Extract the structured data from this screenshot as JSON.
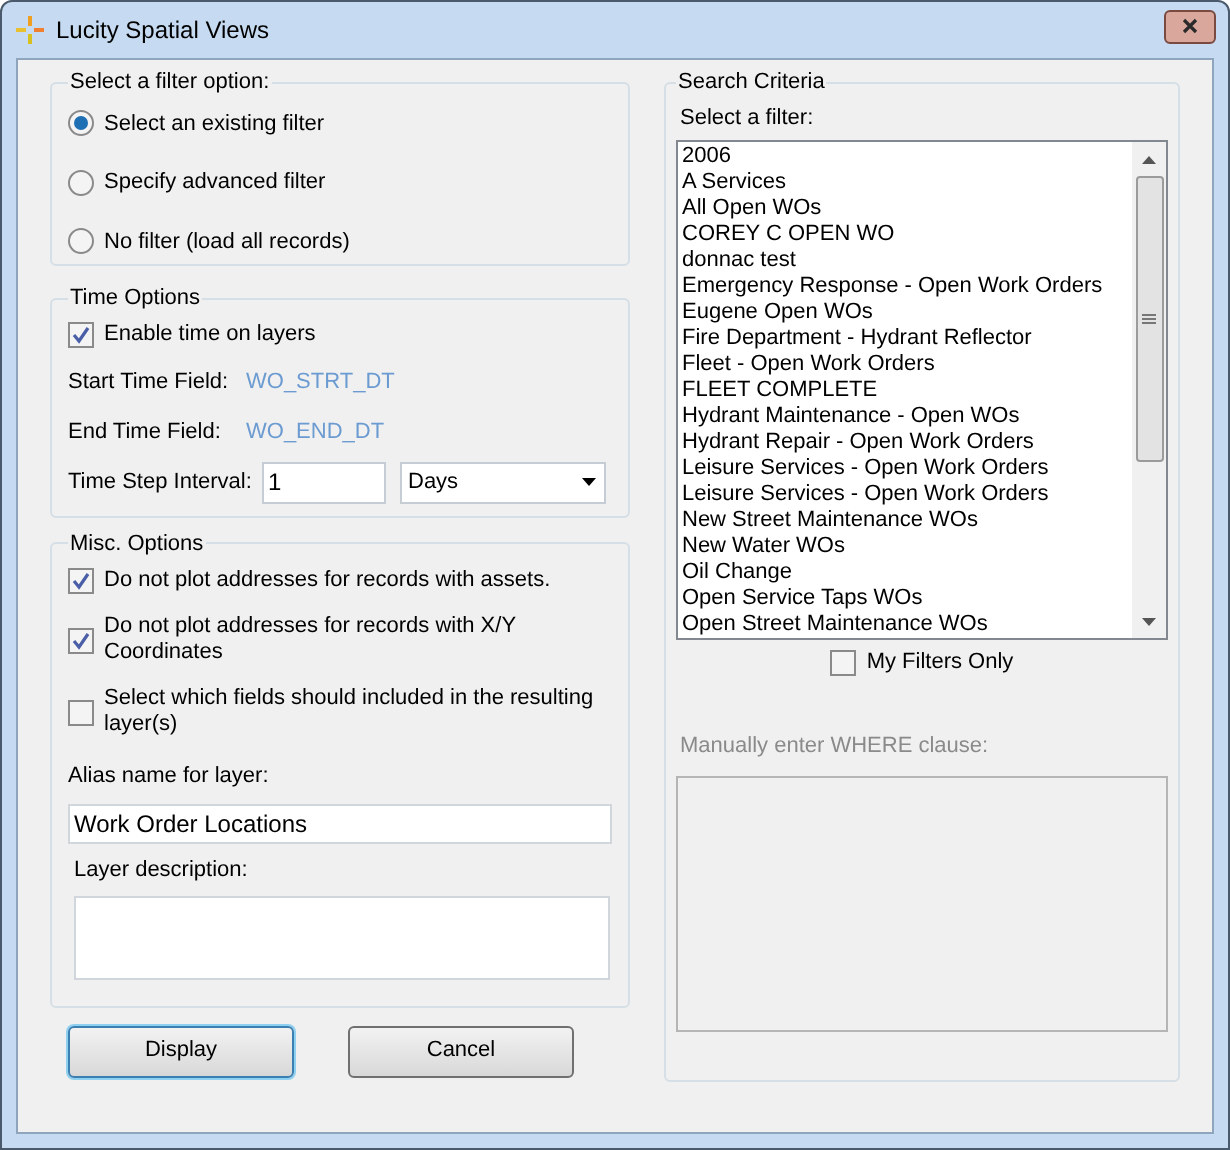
{
  "window": {
    "title": "Lucity Spatial Views"
  },
  "filter_option": {
    "legend": "Select a filter option:",
    "options": [
      {
        "label": "Select an existing filter",
        "selected": true
      },
      {
        "label": "Specify advanced filter",
        "selected": false
      },
      {
        "label": "No filter (load all records)",
        "selected": false
      }
    ]
  },
  "time_options": {
    "legend": "Time Options",
    "enable": {
      "label": "Enable time on layers",
      "checked": true
    },
    "start_label": "Start Time Field:",
    "start_value": "WO_STRT_DT",
    "end_label": "End Time Field:",
    "end_value": "WO_END_DT",
    "interval_label": "Time Step Interval:",
    "interval_value": "1",
    "unit_value": "Days"
  },
  "misc_options": {
    "legend": "Misc. Options",
    "checkboxes": [
      {
        "label": "Do not plot addresses for records with assets.",
        "checked": true
      },
      {
        "label": "Do not plot addresses for records with X/Y Coordinates",
        "checked": true
      },
      {
        "label": "Select which fields should included in the resulting layer(s)",
        "checked": false
      }
    ],
    "alias_label": "Alias name for layer:",
    "alias_value": "Work Order Locations",
    "description_label": "Layer description:"
  },
  "buttons": [
    "Display",
    "Cancel"
  ],
  "search_criteria": {
    "legend": "Search Criteria",
    "list_label": "Select a filter:",
    "filters": [
      "2006",
      "A Services",
      "All Open WOs",
      "COREY C OPEN WO",
      "donnac test",
      "Emergency Response - Open Work Orders",
      "Eugene Open WOs",
      "Fire Department - Hydrant Reflector",
      "Fleet - Open Work Orders",
      "FLEET COMPLETE",
      "Hydrant Maintenance - Open WOs",
      "Hydrant Repair - Open Work Orders",
      "Leisure Services - Open Work Orders",
      "Leisure Services - Open Work Orders",
      "New Street Maintenance WOs",
      "New Water WOs",
      "Oil Change",
      "Open Service Taps WOs",
      "Open Street Maintenance WOs"
    ],
    "my_filters_only": {
      "label": "My Filters Only",
      "checked": false
    },
    "where_clause": {
      "label": "Manually enter WHERE clause:",
      "disabled": true
    }
  }
}
